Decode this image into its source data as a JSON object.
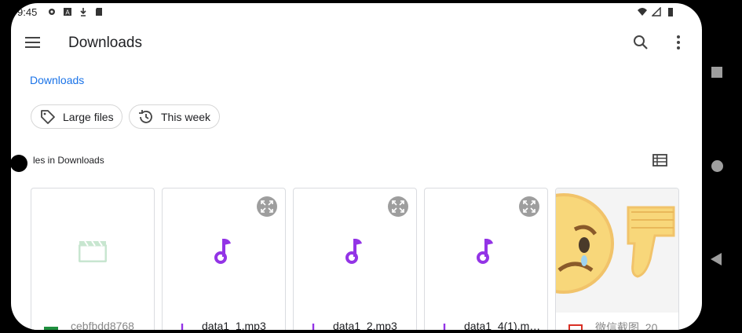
{
  "status_bar": {
    "time": "9:45",
    "left_icons": [
      "settings-icon",
      "a-box-icon",
      "download-icon",
      "sd-card-icon"
    ],
    "right_icons": [
      "wifi-icon",
      "signal-icon",
      "battery-icon"
    ]
  },
  "app_bar": {
    "title": "Downloads",
    "menu_icon": "hamburger-menu-icon",
    "search_icon": "search-icon",
    "more_icon": "more-vert-icon"
  },
  "breadcrumb": "Downloads",
  "chips": [
    {
      "label": "Large files",
      "icon": "tag-icon"
    },
    {
      "label": "This week",
      "icon": "history-icon"
    }
  ],
  "section_title": "les in Downloads",
  "view_toggle_icon": "list-view-icon",
  "files": [
    {
      "name": "cebfbdd8768",
      "type": "video",
      "icon": "video-file-icon"
    },
    {
      "name": "data1_1.mp3",
      "type": "audio",
      "icon": "audio-file-icon"
    },
    {
      "name": "data1_2.mp3",
      "type": "audio",
      "icon": "audio-file-icon"
    },
    {
      "name": "data1_4(1).m…",
      "type": "audio",
      "icon": "audio-file-icon"
    },
    {
      "name": "微信截图_20",
      "type": "image",
      "icon": "image-file-icon"
    }
  ],
  "colors": {
    "accent": "#1a73e8",
    "audio": "#9334e6",
    "video": "#c8e6d0",
    "video_label": "#1e8e3e",
    "image": "#d93025"
  },
  "nav_bar": [
    "recents-icon",
    "home-icon",
    "back-icon"
  ]
}
